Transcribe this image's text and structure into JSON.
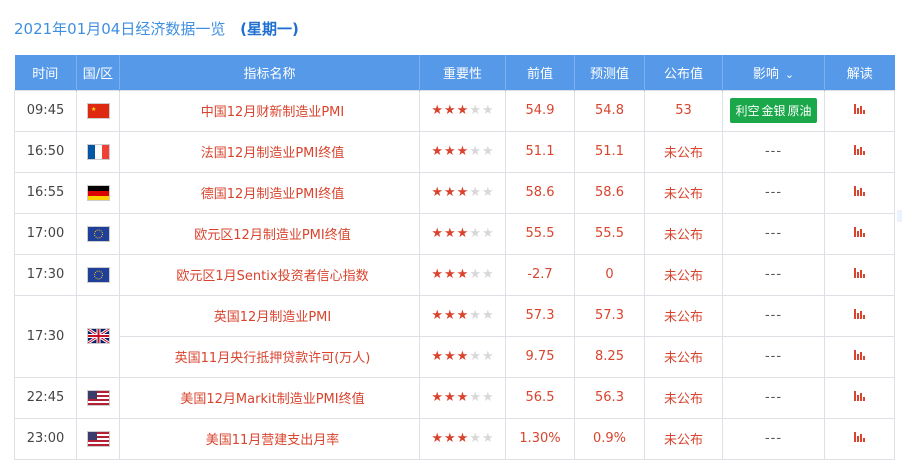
{
  "title": {
    "date": "2021年01月04日经济数据一览",
    "weekday": "(星期一)"
  },
  "columns": {
    "time": "时间",
    "country": "国/区",
    "indicator": "指标名称",
    "importance": "重要性",
    "previous": "前值",
    "forecast": "预测值",
    "actual": "公布值",
    "impact": "影响",
    "analysis": "解读"
  },
  "colors": {
    "header": "#5699e8",
    "accent_red": "#d9442e",
    "tag_green": "#1aa84a"
  },
  "rows": [
    {
      "time": "09:45",
      "flag": "cn-flag-icon",
      "indicator": "中国12月财新制造业PMI",
      "stars": 3,
      "previous": "54.9",
      "forecast": "54.8",
      "actual": "53",
      "impact": [
        "利空",
        "金银",
        "原油"
      ]
    },
    {
      "time": "16:50",
      "flag": "fr-flag-icon",
      "indicator": "法国12月制造业PMI终值",
      "stars": 3,
      "previous": "51.1",
      "forecast": "51.1",
      "actual": "未公布",
      "impact": "---"
    },
    {
      "time": "16:55",
      "flag": "de-flag-icon",
      "indicator": "德国12月制造业PMI终值",
      "stars": 3,
      "previous": "58.6",
      "forecast": "58.6",
      "actual": "未公布",
      "impact": "---"
    },
    {
      "time": "17:00",
      "flag": "eu-flag-icon",
      "indicator": "欧元区12月制造业PMI终值",
      "stars": 3,
      "previous": "55.5",
      "forecast": "55.5",
      "actual": "未公布",
      "impact": "---"
    },
    {
      "time": "17:30",
      "flag": "eu-flag-icon",
      "indicator": "欧元区1月Sentix投资者信心指数",
      "stars": 3,
      "previous": "-2.7",
      "forecast": "0",
      "actual": "未公布",
      "impact": "---"
    },
    {
      "time": "17:30",
      "flag": "uk-flag-icon",
      "indicator": "英国12月制造业PMI",
      "stars": 3,
      "previous": "57.3",
      "forecast": "57.3",
      "actual": "未公布",
      "impact": "---"
    },
    {
      "time": "",
      "flag": "",
      "indicator": "英国11月央行抵押贷款许可(万人)",
      "stars": 3,
      "previous": "9.75",
      "forecast": "8.25",
      "actual": "未公布",
      "impact": "---"
    },
    {
      "time": "22:45",
      "flag": "us-flag-icon",
      "indicator": "美国12月Markit制造业PMI终值",
      "stars": 3,
      "previous": "56.5",
      "forecast": "56.3",
      "actual": "未公布",
      "impact": "---"
    },
    {
      "time": "23:00",
      "flag": "us-flag-icon",
      "indicator": "美国11月营建支出月率",
      "stars": 3,
      "previous": "1.30%",
      "forecast": "0.9%",
      "actual": "未公布",
      "impact": "---"
    }
  ]
}
